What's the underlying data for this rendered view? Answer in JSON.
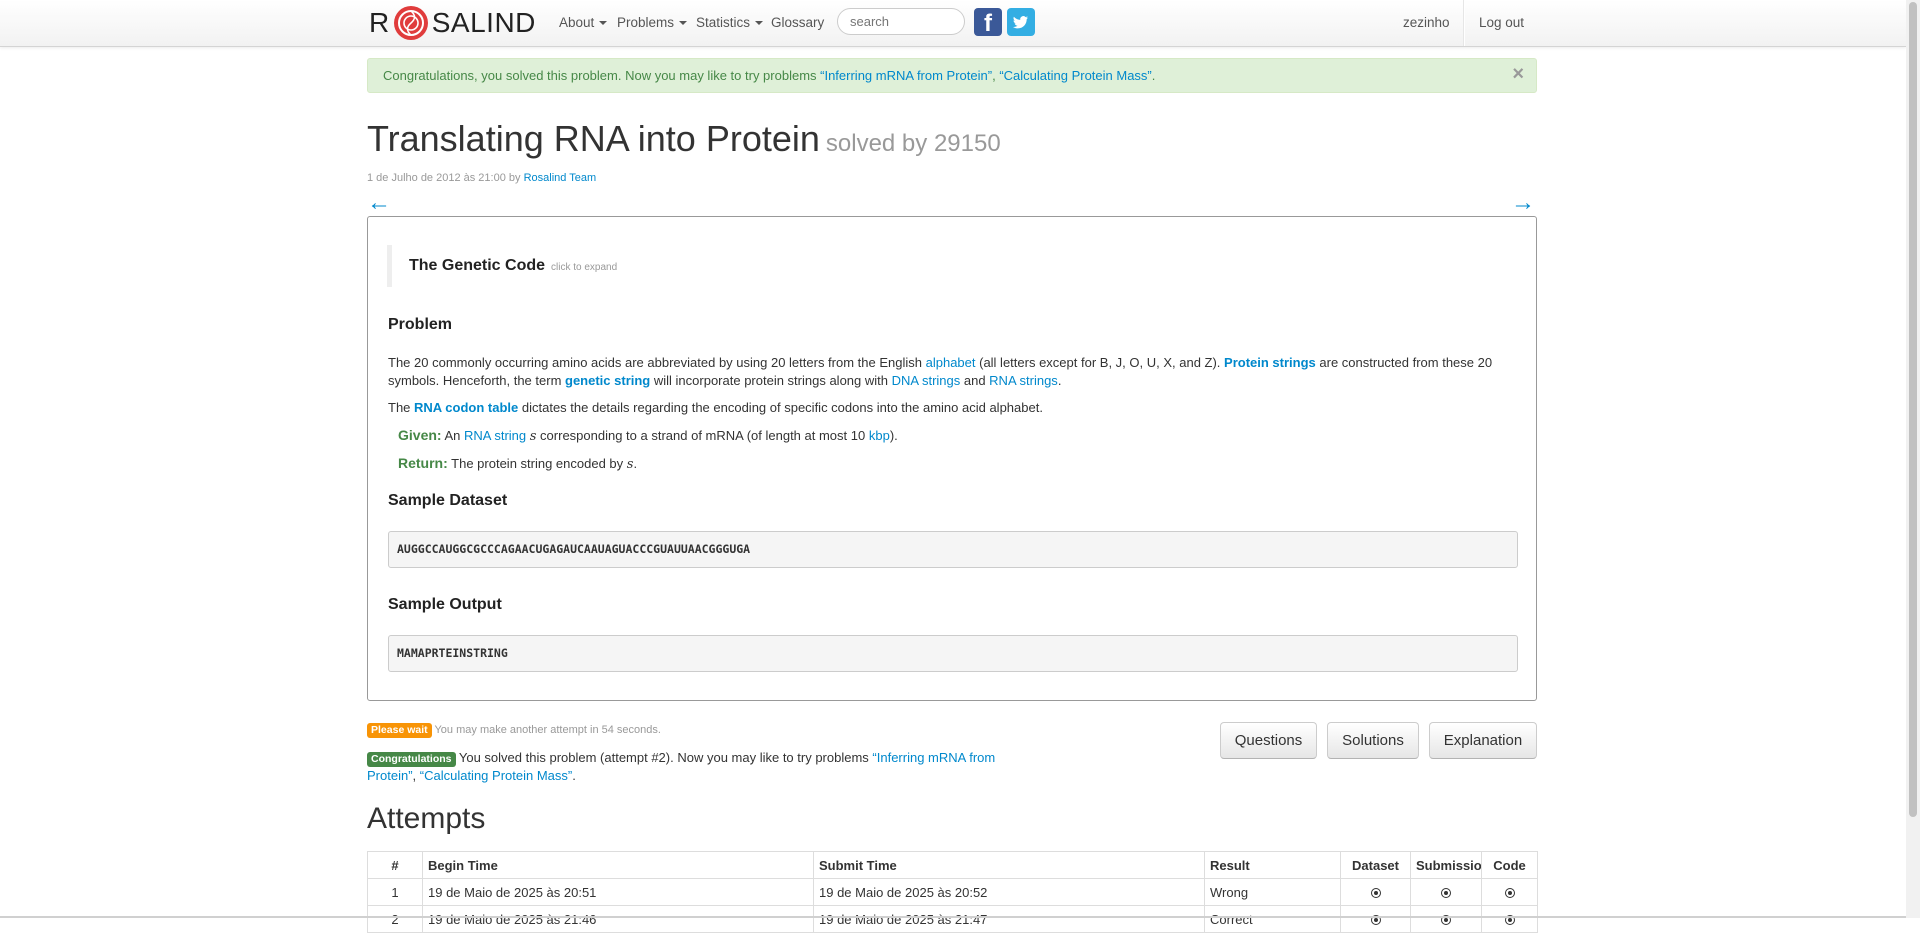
{
  "nav": {
    "brand_left": "R",
    "brand_right": "SALIND",
    "about": "About",
    "problems": "Problems",
    "statistics": "Statistics",
    "glossary": "Glossary",
    "search_placeholder": "search",
    "user": "zezinho",
    "logout": "Log out",
    "facebook_glyph": "f",
    "twitter_icon": "twitter-bird"
  },
  "alert": {
    "text_before": "Congratulations, you solved this problem. Now you may like to try problems ",
    "link1": "“Inferring mRNA from Protein”",
    "sep": ", ",
    "link2": "“Calculating Protein Mass”",
    "text_after": ".",
    "close": "×"
  },
  "problem": {
    "title": "Translating RNA into Protein",
    "solved_by": "solved by 29150",
    "date": "1 de Julho de 2012 às 21:00 by ",
    "author": "Rosalind Team",
    "prev_arrow": "←",
    "next_arrow": "→",
    "genetic_code_heading": "The Genetic Code",
    "click_to_expand": "click to expand",
    "problem_heading": "Problem",
    "p1": {
      "t1": "The 20 commonly occurring amino acids are abbreviated by using 20 letters from the English ",
      "l1": "alphabet",
      "t2": " (all letters except for B, J, O, U, X, and Z). ",
      "l2": "Protein strings",
      "t3": " are constructed from these 20 symbols. Henceforth, the term ",
      "l3": "genetic string",
      "t4": " will incorporate protein strings along with ",
      "l4": "DNA strings",
      "t5": " and ",
      "l5": "RNA strings",
      "t6": "."
    },
    "p2": {
      "t1": "The ",
      "l1": "RNA codon table",
      "t2": " dictates the details regarding the encoding of specific codons into the amino acid alphabet."
    },
    "given": {
      "label": "Given:",
      "t1": " An ",
      "l1": "RNA string",
      "var": "s",
      "t2": " corresponding to a strand of mRNA (of length at most 10 ",
      "l2": "kbp",
      "t3": ")."
    },
    "return": {
      "label": "Return:",
      "t1": " The protein string encoded by ",
      "var": "s",
      "t2": "."
    },
    "sample_dataset_heading": "Sample Dataset",
    "sample_dataset": "AUGGCCAUGGCGCCCAGAACUGAGAUCAAUAGUACCCGUAUUAACGGGUGA",
    "sample_output_heading": "Sample Output",
    "sample_output": "MAMAPRTEINSTRING"
  },
  "status": {
    "wait_label": "Please wait",
    "wait_text": " You may make another attempt in 54 seconds.",
    "congrats_label": "Congratulations",
    "congrats_text": " You solved this problem (attempt #2). Now you may like to try problems ",
    "link1": "“Inferring mRNA from Protein”",
    "sep": ", ",
    "link2": "“Calculating Protein Mass”",
    "end": "."
  },
  "buttons": {
    "questions": "Questions",
    "solutions": "Solutions",
    "explanation": "Explanation"
  },
  "attempts": {
    "heading": "Attempts",
    "columns": [
      "#",
      "Begin Time",
      "Submit Time",
      "Result",
      "Dataset",
      "Submission",
      "Code"
    ],
    "rows": [
      {
        "num": "1",
        "begin": "19 de Maio de 2025 às 20:51",
        "submit": "19 de Maio de 2025 às 20:52",
        "result": "Wrong"
      },
      {
        "num": "2",
        "begin": "19 de Maio de 2025 às 21:46",
        "submit": "19 de Maio de 2025 às 21:47",
        "result": "Correct"
      }
    ]
  }
}
